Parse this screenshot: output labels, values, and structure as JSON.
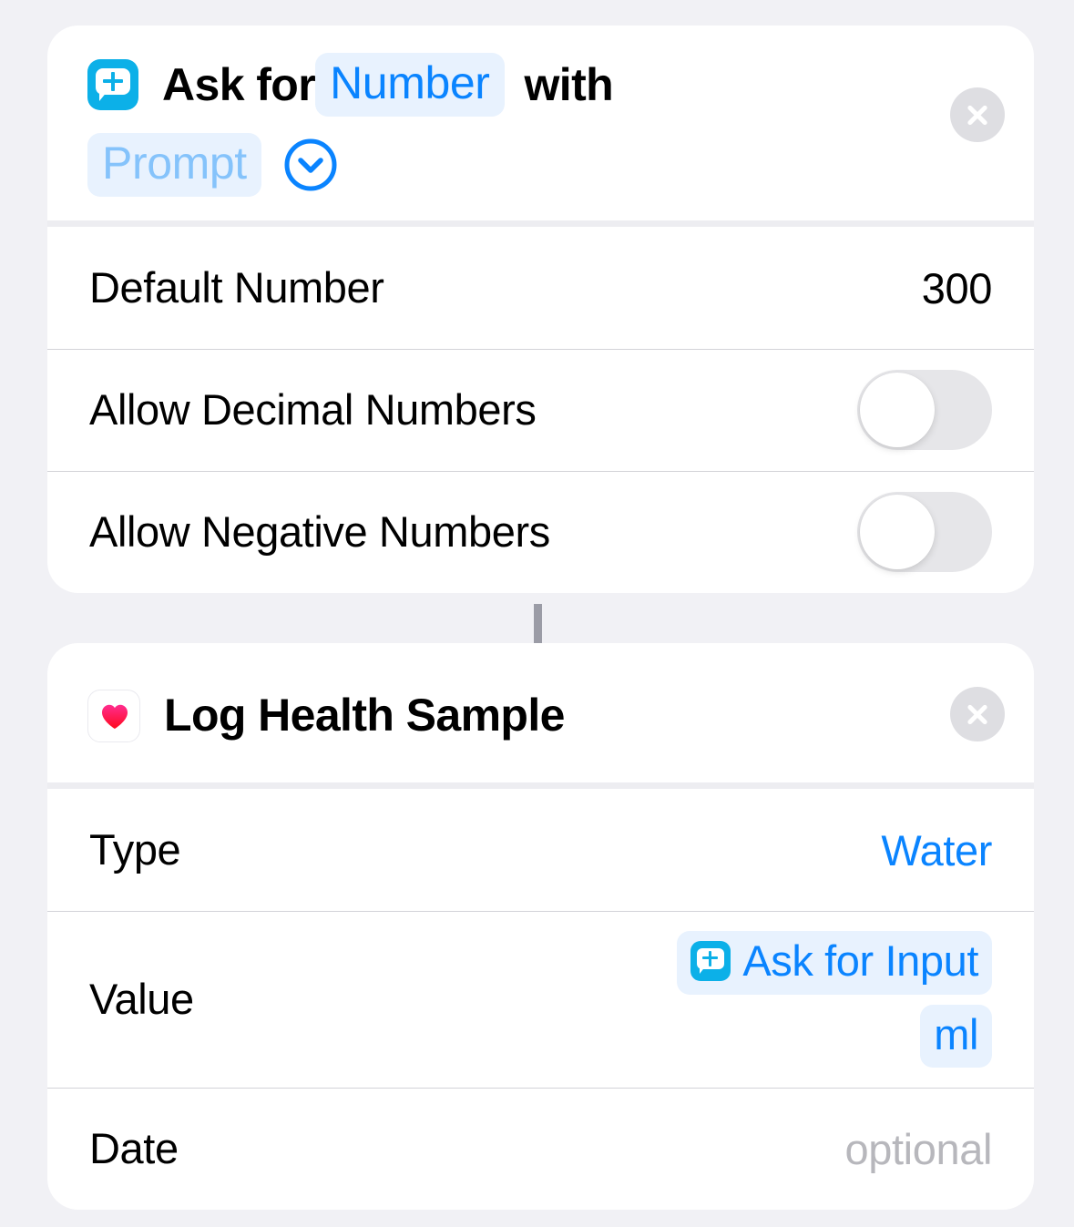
{
  "theme": {
    "background": "#f1f1f5",
    "card_background": "#ffffff",
    "accent_blue": "#0a84ff",
    "chip_background": "#e8f2fe",
    "chip_placeholder_text": "#85c3fb",
    "shortcuts_icon_blue": "#0cb0e8",
    "health_heart_top": "#ff2d8f",
    "health_heart_bottom": "#ff0a1e",
    "muted_text": "#b7b7bc",
    "separator": "#d3d3d8",
    "toggle_off_track": "#e6e6e9",
    "close_button": "#dedee2",
    "connector": "#9b9ca6"
  },
  "actions": [
    {
      "id": "ask-for-input",
      "icon": "shortcuts-ask-for-input-icon",
      "title_parts": {
        "lead": "Ask for",
        "type_token": "Number",
        "joiner": "with",
        "prompt_token": "Prompt"
      },
      "disclosure_icon": "chevron-down-circle-icon",
      "close_icon": "close-icon",
      "rows": [
        {
          "label": "Default Number",
          "value": "300",
          "kind": "value"
        },
        {
          "label": "Allow Decimal Numbers",
          "kind": "toggle",
          "on": false
        },
        {
          "label": "Allow Negative Numbers",
          "kind": "toggle",
          "on": false
        }
      ]
    },
    {
      "id": "log-health-sample",
      "icon": "health-heart-icon",
      "title": "Log Health Sample",
      "close_icon": "close-icon",
      "rows": [
        {
          "label": "Type",
          "value": "Water",
          "kind": "accent-value"
        },
        {
          "label": "Value",
          "kind": "token-stack",
          "tokens": [
            {
              "text": "Ask for Input",
              "icon": "shortcuts-ask-for-input-icon"
            },
            {
              "text": "ml"
            }
          ]
        },
        {
          "label": "Date",
          "value": "optional",
          "kind": "placeholder-value"
        }
      ]
    }
  ]
}
